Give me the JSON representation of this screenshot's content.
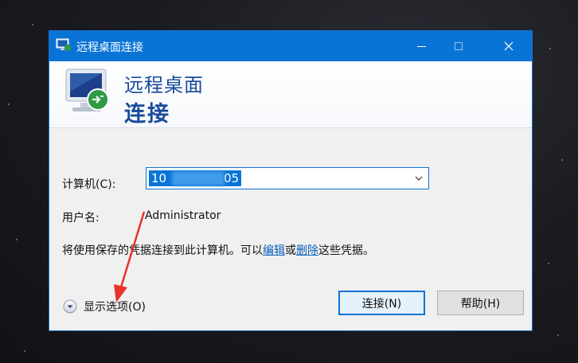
{
  "window": {
    "title": "远程桌面连接",
    "accent": "#0a74d6"
  },
  "header": {
    "line1": "远程桌面",
    "line2": "连接"
  },
  "form": {
    "computer_label": "计算机(C):",
    "computer_value_start": "10",
    "computer_value_end": "05",
    "user_label": "用户名:",
    "user_value": "Administrator",
    "info_prefix": "将使用保存的凭据连接到此计算机。可以",
    "info_link_edit": "编辑",
    "info_or": "或",
    "info_link_delete": "删除",
    "info_suffix": "这些凭据。"
  },
  "footer": {
    "show_options_label": "显示选项(O)",
    "connect_label": "连接(N)",
    "help_label": "帮助(H)"
  },
  "annotation": {
    "arrow_color": "#e8322b"
  }
}
